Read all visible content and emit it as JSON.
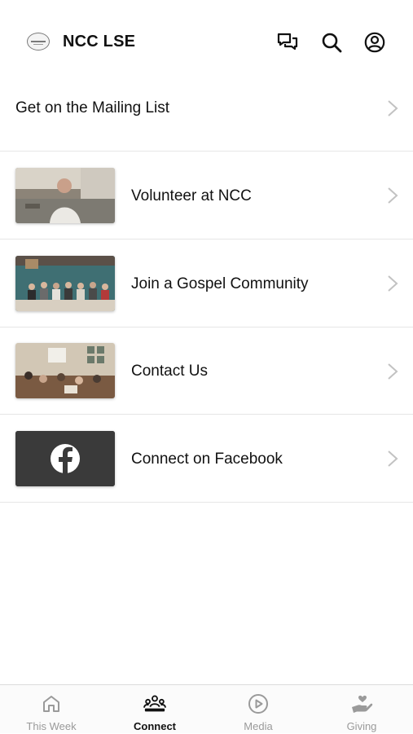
{
  "header": {
    "title": "NCC LSE",
    "logo_icon": "church-logo-icon",
    "icons": [
      "chat-icon",
      "search-icon",
      "account-icon"
    ]
  },
  "list": {
    "items": [
      {
        "label": "Get on the Mailing List",
        "thumbnail": null
      },
      {
        "label": "Volunteer at NCC",
        "thumbnail": "volunteer-photo"
      },
      {
        "label": "Join a Gospel Community",
        "thumbnail": "group-photo"
      },
      {
        "label": "Contact Us",
        "thumbnail": "living-room-photo"
      },
      {
        "label": "Connect on Facebook",
        "thumbnail": "facebook-icon"
      }
    ]
  },
  "tabbar": {
    "tabs": [
      {
        "label": "This Week",
        "icon": "home-icon",
        "active": false
      },
      {
        "label": "Connect",
        "icon": "people-icon",
        "active": true
      },
      {
        "label": "Media",
        "icon": "play-icon",
        "active": false
      },
      {
        "label": "Giving",
        "icon": "giving-hand-icon",
        "active": false
      }
    ]
  },
  "colors": {
    "text": "#111111",
    "inactive": "#9a9a9a",
    "divider": "#e6e6e6",
    "facebook_tile": "#3a3a3a"
  }
}
